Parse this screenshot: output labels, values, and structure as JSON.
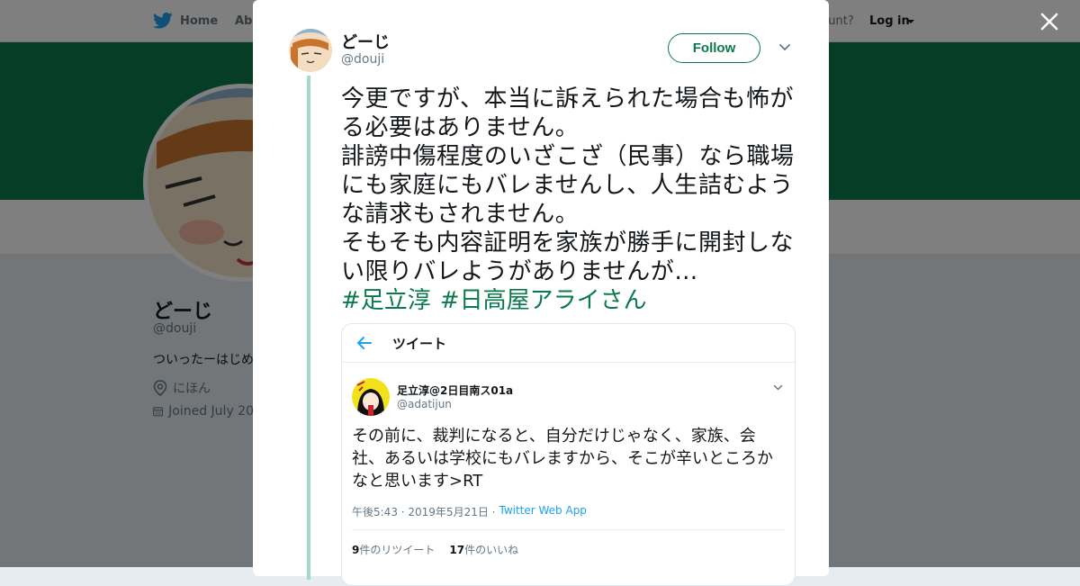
{
  "nav": {
    "home_label": "Home",
    "about_label": "Abo",
    "account_prompt": "ccount?",
    "login_label": "Log in"
  },
  "profile": {
    "name": "どーじ",
    "handle": "@douji",
    "bio": "ついったーはじめ",
    "location": "にほん",
    "joined": "Joined July 20"
  },
  "tweet": {
    "author_name": "どーじ",
    "author_handle": "@douji",
    "follow_label": "Follow",
    "lines": [
      "今更ですが、本当に訴えられた場合も怖がる必要はありません。",
      "誹謗中傷程度のいざこざ（民事）なら職場にも家庭にもバレませんし、人生詰むような請求もされません。",
      "そもそも内容証明を家族が勝手に開封しない限りバレようがありませんが…"
    ],
    "hashtags": [
      "#足立淳",
      "#日高屋アライさん"
    ]
  },
  "embedded": {
    "header_title": "ツイート",
    "author_name": "足立淳@2日目南ス01a",
    "author_handle": "@adatijun",
    "text": "その前に、裁判になると、自分だけじゃなく、家族、会社、あるいは学校にもバレますから、そこが辛いところかなと思います>RT",
    "time": "午後5:43 · 2019年5月21日 ·",
    "app": "Twitter Web App",
    "retweets_count": "9",
    "retweets_label": "件のリツイート",
    "likes_count": "17",
    "likes_label": "件のいいね"
  },
  "colors": {
    "accent": "#0a7a4e",
    "thread_line": "#a4d9c7",
    "link_blue": "#1da1f2"
  }
}
